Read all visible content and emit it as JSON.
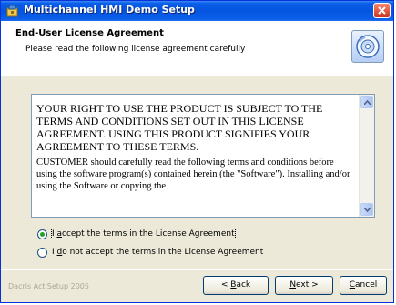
{
  "window": {
    "title": "Multichannel HMI Demo Setup"
  },
  "header": {
    "title": "End-User License Agreement",
    "subtitle": "Please read the following license agreement carefully"
  },
  "license": {
    "paragraph_1": "YOUR RIGHT TO USE THE PRODUCT IS SUBJECT TO THE TERMS AND CONDITIONS SET OUT IN THIS LICENSE AGREEMENT. USING THIS PRODUCT SIGNIFIES YOUR AGREEMENT TO THESE TERMS.",
    "paragraph_2": "CUSTOMER should carefully read the following terms and conditions before using the software program(s) contained herein (the \"Software\"). Installing and/or using the Software or copying the"
  },
  "options": {
    "accept": {
      "pre": "I ",
      "key": "a",
      "post": "ccept the terms in the License Agreement",
      "checked": true
    },
    "decline": {
      "pre": "I ",
      "key": "d",
      "post": "o not accept the terms in the License Agreement",
      "checked": false
    }
  },
  "footer": {
    "brand": "Dacris ActiSetup 2005",
    "back": {
      "pre": "< ",
      "key": "B",
      "post": "ack"
    },
    "next": {
      "pre": "",
      "key": "N",
      "post": "ext >"
    },
    "cancel": {
      "pre": "",
      "key": "C",
      "post": "ancel"
    }
  },
  "colors": {
    "titlebar": "#0554e0",
    "radio_dot": "#21a121",
    "dialog_bg": "#ece9d8"
  }
}
